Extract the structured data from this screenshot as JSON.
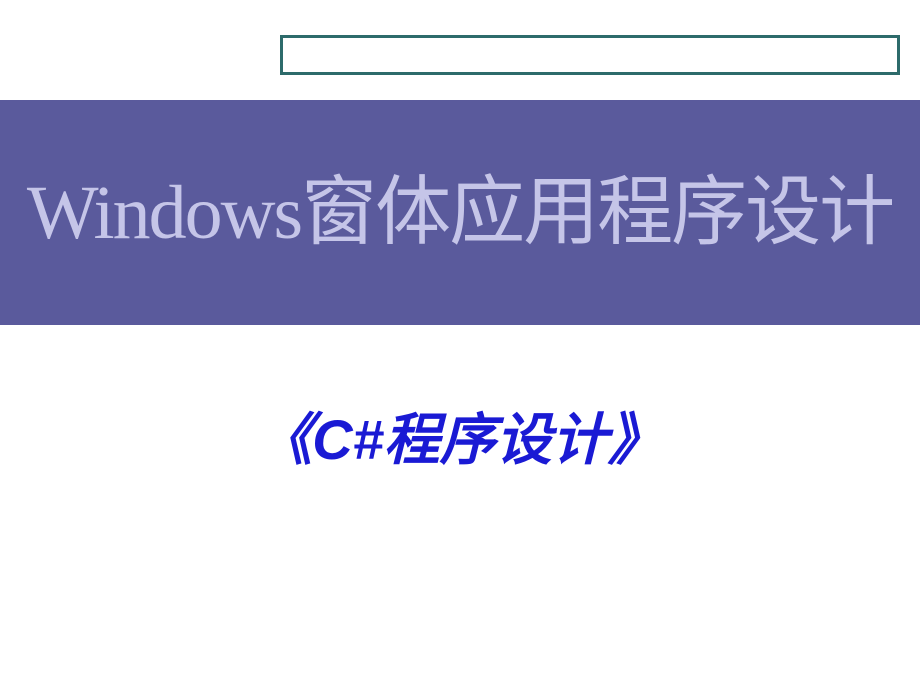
{
  "slide": {
    "title": "Windows窗体应用程序设计",
    "subtitle": "《C#程序设计》"
  },
  "colors": {
    "banner_bg": "#5a5a9c",
    "title_color": "#c5c5e8",
    "subtitle_color": "#1a1ad4",
    "deco_border": "#2d6b6b"
  }
}
